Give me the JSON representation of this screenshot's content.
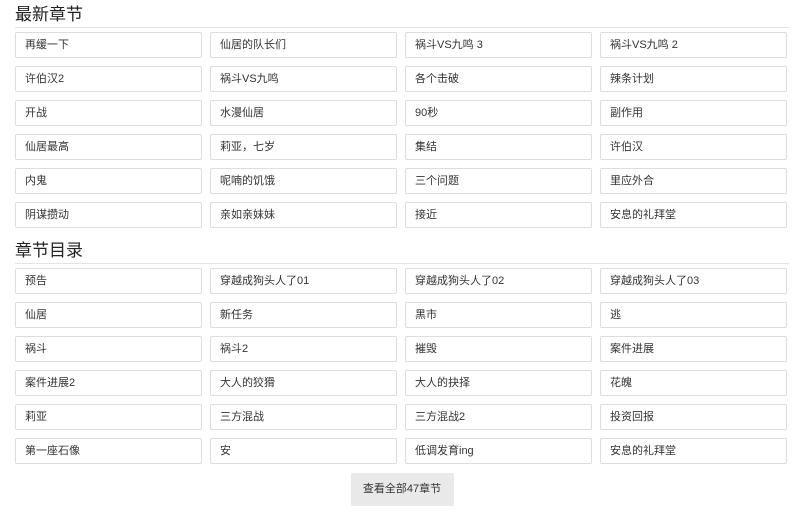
{
  "latest": {
    "title": "最新章节",
    "chapters": [
      "再缓一下",
      "仙居的队长们",
      "祸斗VS九鸣 3",
      "祸斗VS九鸣 2",
      "许伯汉2",
      "祸斗VS九鸣",
      "各个击破",
      "辣条计划",
      "开战",
      "水漫仙居",
      "90秒",
      "副作用",
      "仙居最高",
      "莉亚，七岁",
      "集结",
      "许伯汉",
      "内鬼",
      "呢喃的饥饿",
      "三个问题",
      "里应外合",
      "阴谋攒动",
      "亲如亲妹妹",
      "接近",
      "安息的礼拜堂"
    ]
  },
  "catalog": {
    "title": "章节目录",
    "chapters": [
      "预告",
      "穿越成狗头人了01",
      "穿越成狗头人了02",
      "穿越成狗头人了03",
      "仙居",
      "新任务",
      "黑市",
      "逃",
      "祸斗",
      "祸斗2",
      "摧毁",
      "案件进展",
      "案件进展2",
      "大人的狡猾",
      "大人的抉择",
      "花魄",
      "莉亚",
      "三方混战",
      "三方混战2",
      "投资回报",
      "第一座石像",
      "安",
      "低调发育ing",
      "安息的礼拜堂"
    ]
  },
  "view_all_label": "查看全部47章节"
}
